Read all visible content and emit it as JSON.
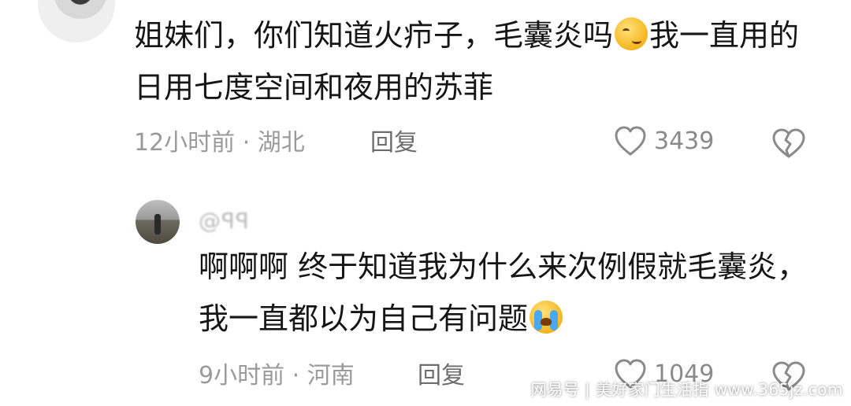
{
  "comments": [
    {
      "text_before_emoji": "姐妹们，你们知道火疖子，毛囊炎吗",
      "emoji": "smirk-emoji",
      "text_after_emoji": "我一直用的日用七度空间和夜用的苏菲",
      "time": "12小时前",
      "location": "湖北",
      "reply_label": "回复",
      "like_count": "3439"
    }
  ],
  "reply": {
    "username": "@ꟼꟼ",
    "text_before_emoji": "啊啊啊 终于知道我为什么来次例假就毛囊炎，我一直都以为自己有问题",
    "emoji": "crying-emoji",
    "time": "9小时前",
    "location": "河南",
    "reply_label": "回复",
    "like_count": "1049"
  },
  "meta_separator": " · ",
  "watermark": "网易号 | 美好家门生活指 www.365jz.com",
  "colors": {
    "text": "#161616",
    "meta": "#9a9a9a",
    "icon": "#8a8a8a"
  }
}
